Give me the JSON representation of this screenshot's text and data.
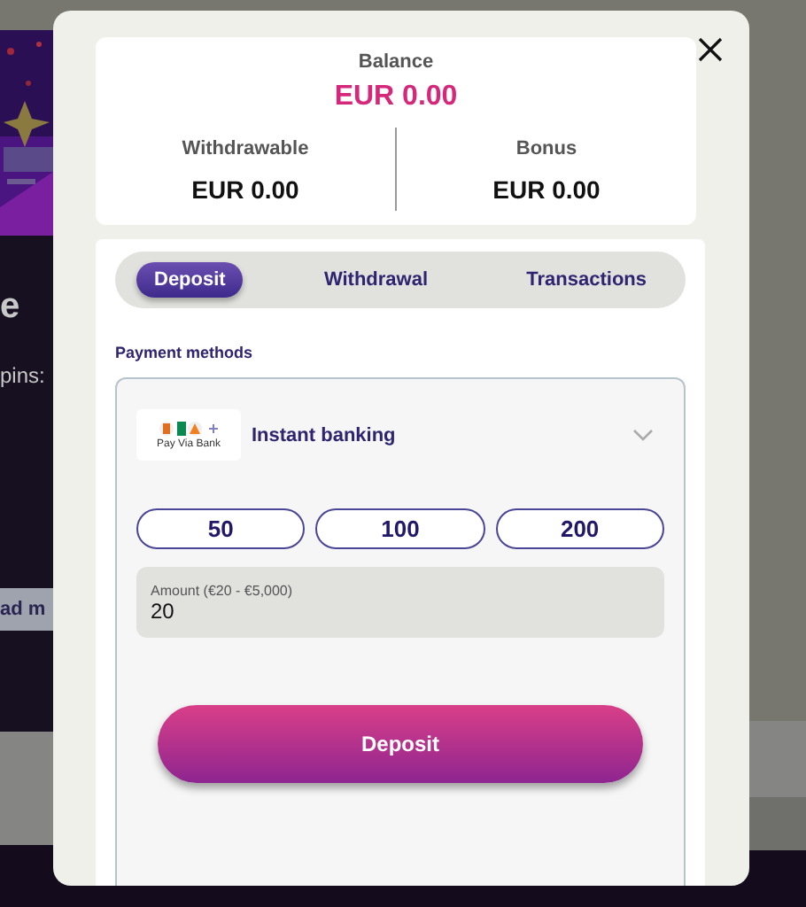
{
  "background": {
    "heading": "e",
    "text": "pins:",
    "button": "ad m"
  },
  "dialog": {
    "balance": {
      "label": "Balance",
      "value": "EUR 0.00"
    },
    "sub_balances": [
      {
        "label": "Withdrawable",
        "value": "EUR 0.00"
      },
      {
        "label": "Bonus",
        "value": "EUR 0.00"
      }
    ],
    "tabs": [
      {
        "label": "Deposit",
        "selected": true
      },
      {
        "label": "Withdrawal",
        "selected": false
      },
      {
        "label": "Transactions",
        "selected": false
      }
    ],
    "payment_methods_label": "Payment methods",
    "method": {
      "name": "Instant banking",
      "logo_text": "Pay Via Bank"
    },
    "amount_presets": [
      "50",
      "100",
      "200"
    ],
    "amount_field": {
      "label": "Amount (€20 - €5,000)",
      "value": "20"
    },
    "submit": "Deposit"
  }
}
